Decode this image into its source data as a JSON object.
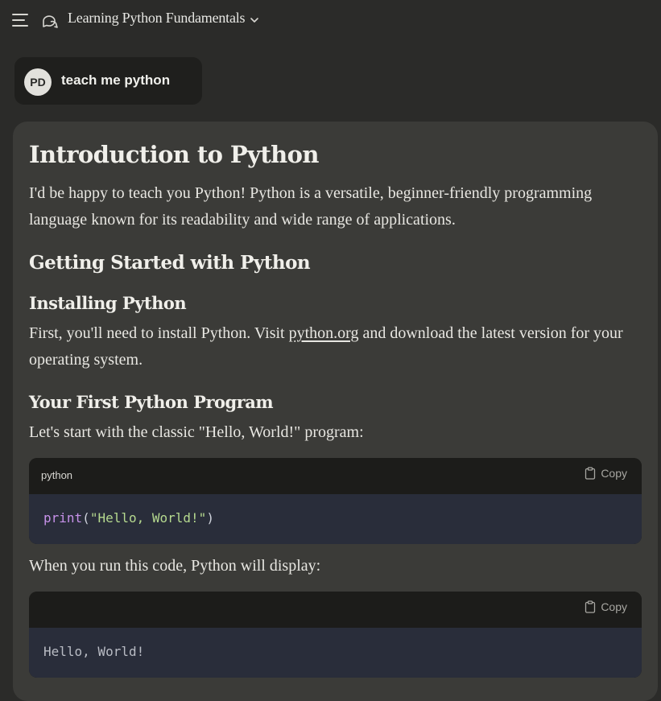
{
  "header": {
    "conversation_title": "Learning Python Fundamentals",
    "menu_icon": "hamburger-menu-icon",
    "chat_icon": "chat-bubbles-icon",
    "dropdown_icon": "chevron-down-icon"
  },
  "user_message": {
    "avatar_initials": "PD",
    "text": "teach me python"
  },
  "response": {
    "title": "Introduction to Python",
    "intro": "I'd be happy to teach you Python! Python is a versatile, beginner-friendly programming language known for its readability and wide range of applications.",
    "section_heading": "Getting Started with Python",
    "install_heading": "Installing Python",
    "install_text_before": "First, you'll need to install Python. Visit ",
    "install_link": "python.org",
    "install_text_after": " and download the latest version for your operating system.",
    "first_program_heading": "Your First Python Program",
    "first_program_text": "Let's start with the classic \"Hello, World!\" program:",
    "code_block_1": {
      "language": "python",
      "copy_label": "Copy",
      "code_fn": "print",
      "code_open": "(",
      "code_str": "\"Hello, World!\"",
      "code_close": ")"
    },
    "run_text": "When you run this code, Python will display:",
    "code_block_2": {
      "language": "",
      "copy_label": "Copy",
      "output": "Hello, World!"
    }
  },
  "colors": {
    "background": "#2b2b29",
    "card": "#3b3b38",
    "code_header": "#1c1c1a",
    "code_body": "#292d3a",
    "keyword": "#c792ea",
    "string": "#b5d98f"
  }
}
